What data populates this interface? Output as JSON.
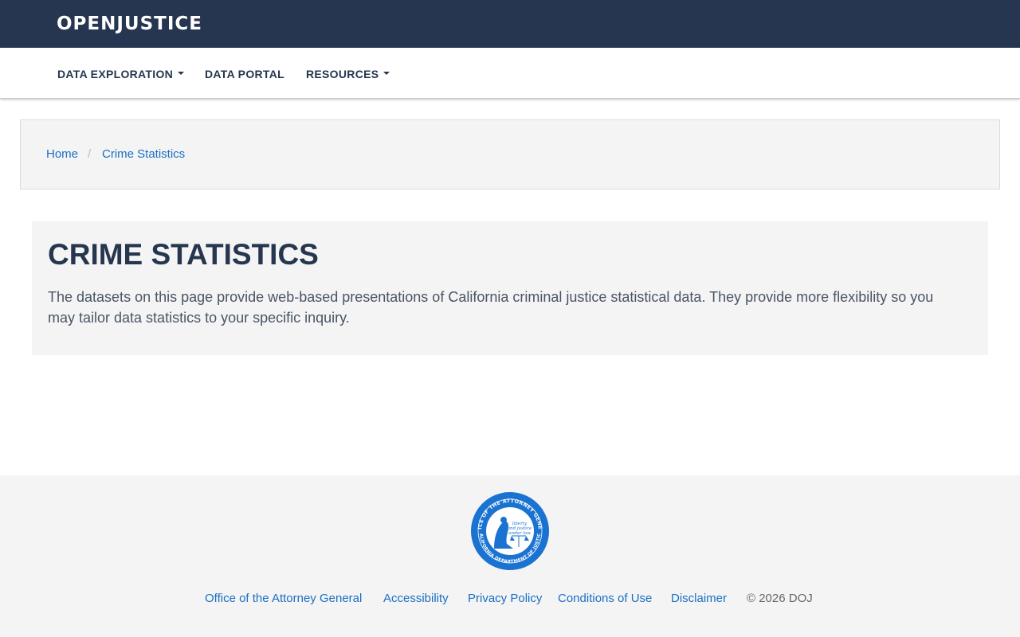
{
  "header": {
    "logo_text": "OPENJUSTICE"
  },
  "nav": {
    "items": [
      {
        "label": "DATA EXPLORATION",
        "has_dropdown": true
      },
      {
        "label": "DATA PORTAL",
        "has_dropdown": false
      },
      {
        "label": "RESOURCES",
        "has_dropdown": true
      }
    ]
  },
  "breadcrumb": {
    "items": [
      "Home",
      "Crime Statistics"
    ],
    "separator": "/"
  },
  "hero": {
    "title": "CRIME STATISTICS",
    "description": "The datasets on this page provide web-based presentations of California criminal justice statistical data. They provide more flexibility so you may tailor data statistics to your specific inquiry."
  },
  "footer": {
    "seal_top_text": "OFFICE OF THE ATTORNEY GENERAL",
    "seal_bottom_text": "CALIFORNIA DEPARTMENT OF JUSTICE",
    "seal_motto": [
      "liberty",
      "and justice",
      "under law"
    ],
    "links": [
      "Office of the Attorney General",
      "Accessibility",
      "Privacy Policy",
      "Conditions of Use",
      "Disclaimer"
    ],
    "copyright": "© 2026 DOJ"
  },
  "colors": {
    "header_bg": "#263650",
    "link": "#1a6fc2",
    "panel_bg": "#f4f4f4",
    "seal_blue": "#1a73d1"
  }
}
